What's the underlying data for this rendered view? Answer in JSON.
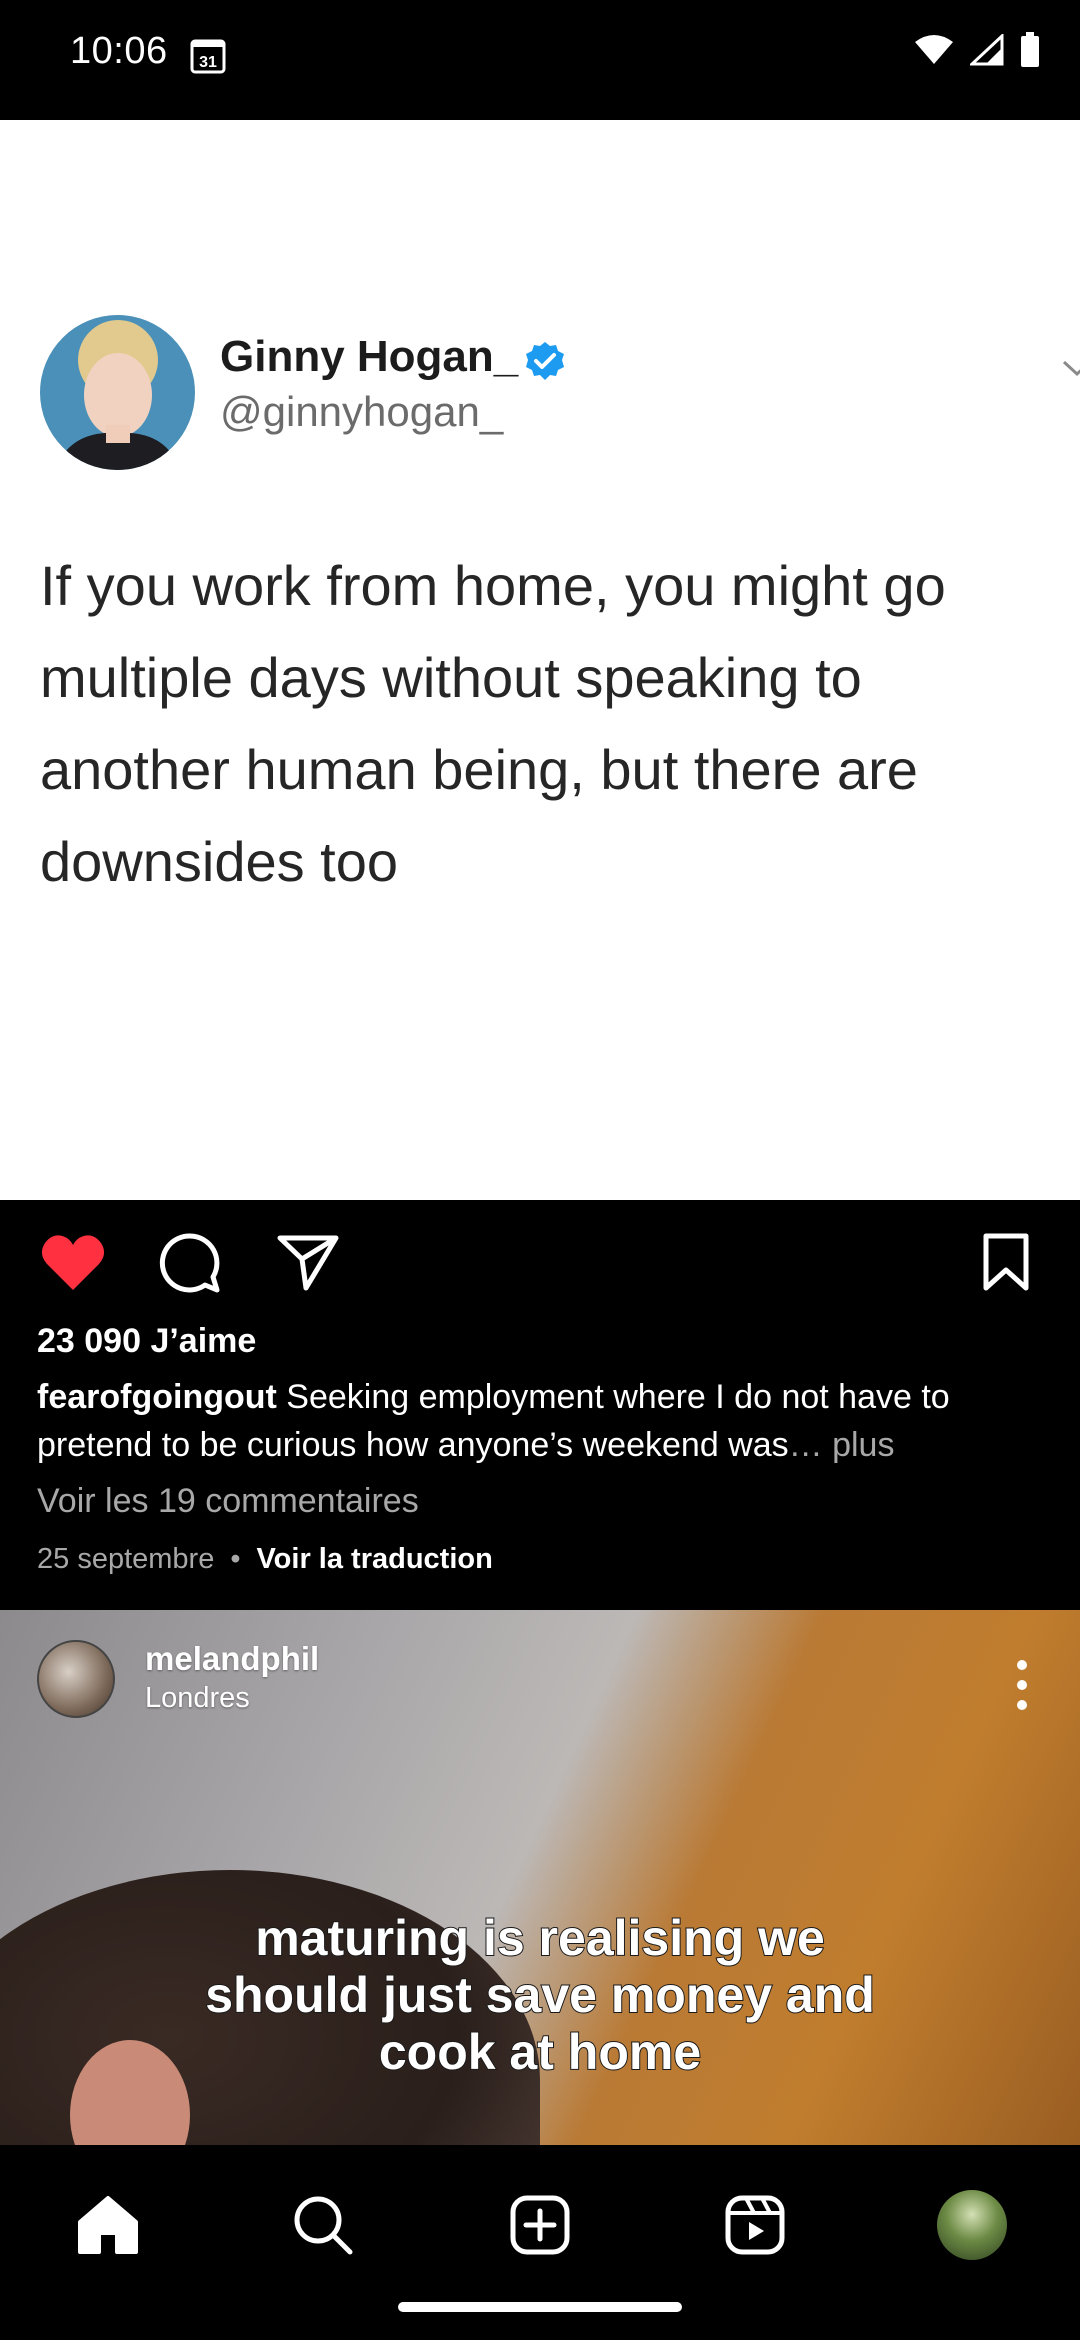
{
  "status_bar": {
    "time": "10:06",
    "calendar_day": "31"
  },
  "post1": {
    "tweet": {
      "name": "Ginny Hogan_",
      "handle": "@ginnyhogan_",
      "text": "If you work from home, you might go multiple days without speaking to another human being, but there are downsides too"
    },
    "likes": "23 090 J’aime",
    "caption_user": "fearofgoingout",
    "caption_text": " Seeking employment where I do not have to pretend to be curious how anyone’s weekend was",
    "caption_more": "… plus",
    "comments_link": "Voir les 19 commentaires",
    "date": "25 septembre",
    "separator": "•",
    "translate": "Voir la traduction",
    "liked": true
  },
  "post2": {
    "user": "melandphil",
    "location": "Londres",
    "video_caption": "maturing is realising we should just save money and cook at home"
  },
  "colors": {
    "like_red": "#ff3040",
    "verified_blue": "#1d9bf0",
    "muted": "#a8a8a8"
  },
  "icons": [
    "heart-icon",
    "comment-icon",
    "share-icon",
    "bookmark-icon",
    "home-icon",
    "search-icon",
    "create-icon",
    "reels-icon",
    "profile-avatar"
  ]
}
